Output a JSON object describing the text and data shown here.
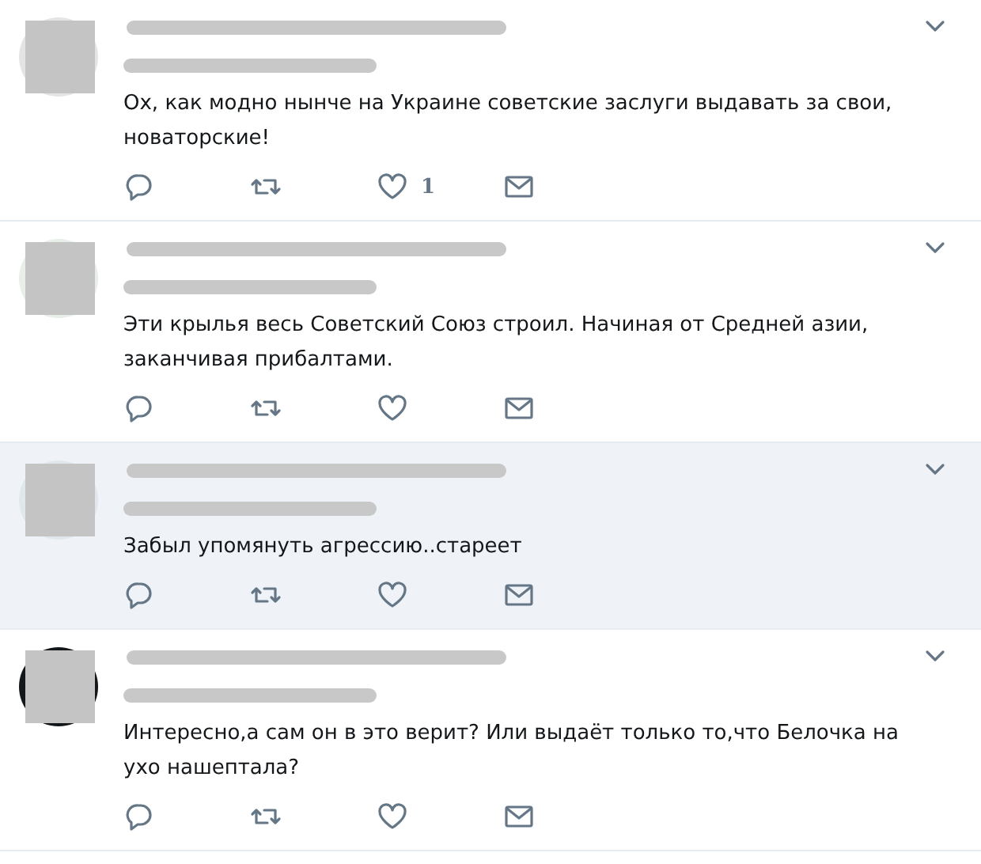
{
  "tweets": [
    {
      "avatar": {
        "color": "#e4e4e4"
      },
      "highlighted": false,
      "text": "Ох, как модно нынче на Украине советские заслуги выдавать за свои, новаторские!",
      "like_count": "1"
    },
    {
      "avatar": {
        "color": "#e8efe8"
      },
      "highlighted": false,
      "text": "Эти крылья весь Советский Союз строил. Начиная от Средней азии, заканчивая прибалтами."
    },
    {
      "avatar": {
        "color": "#e1e8ed"
      },
      "highlighted": true,
      "text": "Забыл упомянуть агрессию..стареет"
    },
    {
      "avatar": {
        "color": "#14171a"
      },
      "highlighted": false,
      "text": "Интересно,а сам он в это верит? Или выдаёт только то,что Белочка на ухо нашептала?"
    }
  ]
}
